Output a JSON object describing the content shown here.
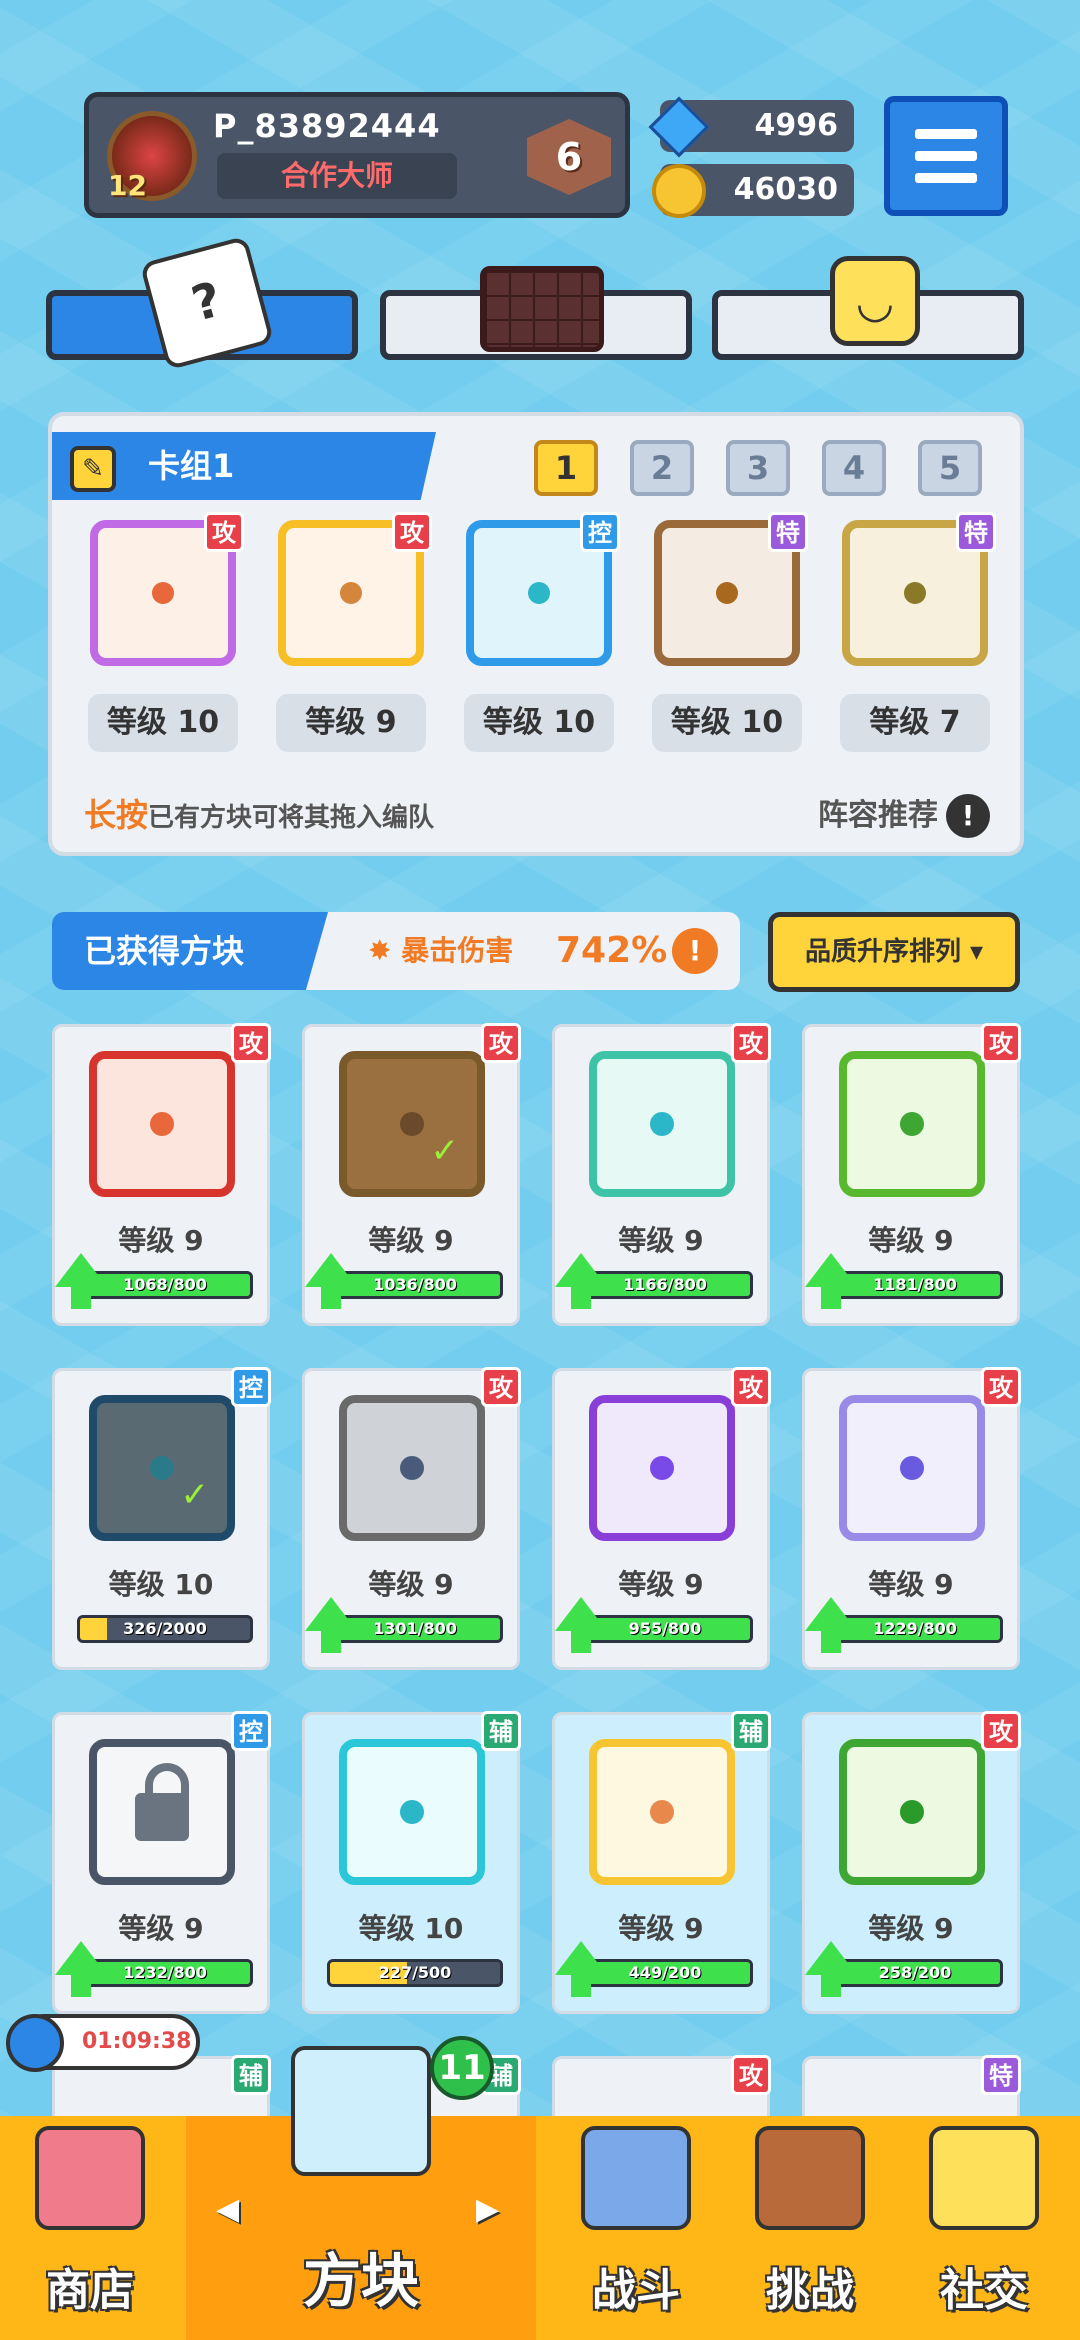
{
  "player": {
    "name": "P_83892444",
    "title": "合作大师",
    "level": "12",
    "rank": "6"
  },
  "currency": {
    "gems": "4996",
    "coins": "46030"
  },
  "deck": {
    "title": "卡组1",
    "tabs": [
      "1",
      "2",
      "3",
      "4",
      "5"
    ],
    "active_tab": "1",
    "slots": [
      {
        "tag": "攻",
        "level": "等级 10"
      },
      {
        "tag": "攻",
        "level": "等级 9"
      },
      {
        "tag": "控",
        "level": "等级 10"
      },
      {
        "tag": "特",
        "level": "等级 10"
      },
      {
        "tag": "特",
        "level": "等级 7"
      }
    ],
    "hint_strong": "长按",
    "hint": "已有方块可将其拖入编队",
    "recommend": "阵容推荐"
  },
  "owned": {
    "title": "已获得方块",
    "crit_label": "暴击伤害",
    "crit_value": "742%",
    "sort_label": "品质升序排列 ▾"
  },
  "cards": [
    {
      "tag": "攻",
      "level": "等级 9",
      "progress": "1068/800"
    },
    {
      "tag": "攻",
      "level": "等级 9",
      "progress": "1036/800"
    },
    {
      "tag": "攻",
      "level": "等级 9",
      "progress": "1166/800"
    },
    {
      "tag": "攻",
      "level": "等级 9",
      "progress": "1181/800"
    },
    {
      "tag": "控",
      "level": "等级 10",
      "progress": "326/2000"
    },
    {
      "tag": "攻",
      "level": "等级 9",
      "progress": "1301/800"
    },
    {
      "tag": "攻",
      "level": "等级 9",
      "progress": "955/800"
    },
    {
      "tag": "攻",
      "level": "等级 9",
      "progress": "1229/800"
    },
    {
      "tag": "控",
      "level": "等级 9",
      "progress": "1232/800"
    },
    {
      "tag": "辅",
      "level": "等级 10",
      "progress": "227/500"
    },
    {
      "tag": "辅",
      "level": "等级 9",
      "progress": "449/200"
    },
    {
      "tag": "攻",
      "level": "等级 9",
      "progress": "258/200"
    }
  ],
  "partial_tags": [
    "辅",
    "辅",
    "攻",
    "特"
  ],
  "timer": "01:09:38",
  "nav": {
    "shop": "商店",
    "blocks": "方块",
    "battle": "战斗",
    "challenge": "挑战",
    "social": "社交",
    "blocks_badge": "11"
  }
}
